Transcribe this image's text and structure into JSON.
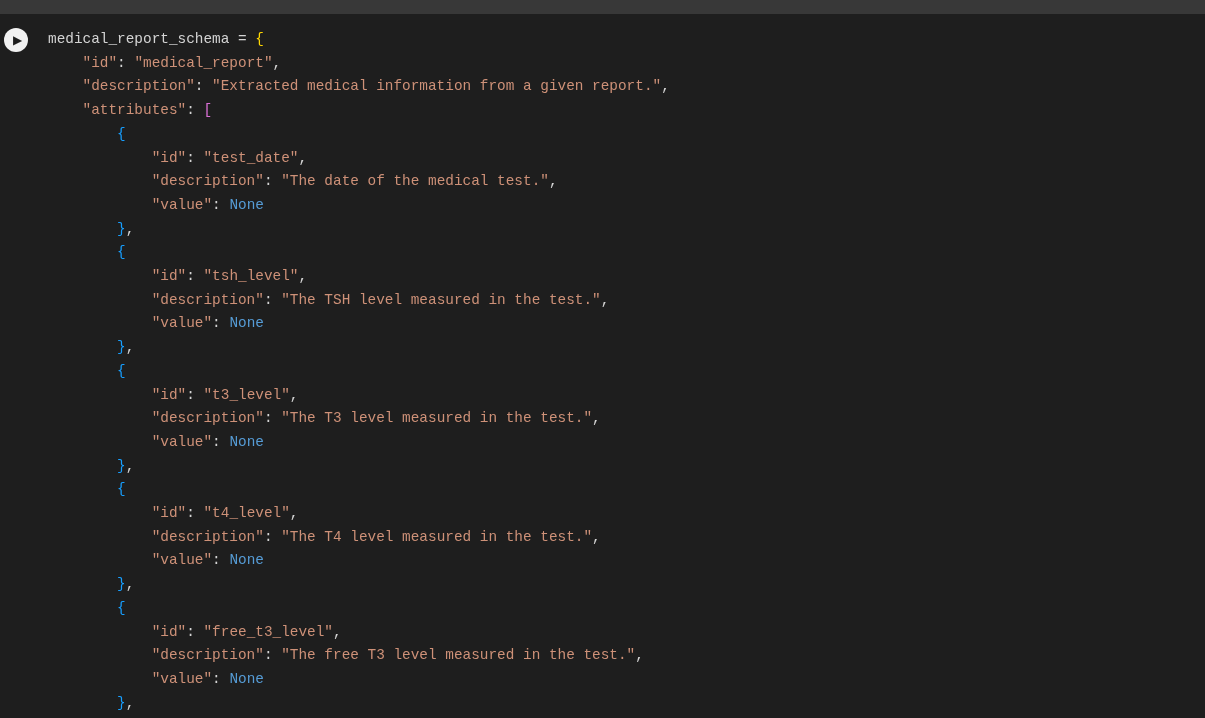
{
  "cell": {
    "run_button": {
      "label": "▶"
    },
    "lines": [
      [
        {
          "kind": "plain",
          "text": "medical_report_schema = "
        },
        {
          "kind": "bracket-1",
          "text": "{"
        }
      ],
      [
        {
          "kind": "string",
          "text": "    \"id\""
        },
        {
          "kind": "plain",
          "text": ": "
        },
        {
          "kind": "string",
          "text": "\"medical_report\""
        },
        {
          "kind": "plain",
          "text": ","
        }
      ],
      [
        {
          "kind": "string",
          "text": "    \"description\""
        },
        {
          "kind": "plain",
          "text": ": "
        },
        {
          "kind": "string",
          "text": "\"Extracted medical information from a given report.\""
        },
        {
          "kind": "plain",
          "text": ","
        }
      ],
      [
        {
          "kind": "string",
          "text": "    \"attributes\""
        },
        {
          "kind": "plain",
          "text": ": "
        },
        {
          "kind": "bracket-2",
          "text": "["
        }
      ],
      [
        {
          "kind": "bracket-3",
          "text": "        {"
        }
      ],
      [
        {
          "kind": "string",
          "text": "            \"id\""
        },
        {
          "kind": "plain",
          "text": ": "
        },
        {
          "kind": "string",
          "text": "\"test_date\""
        },
        {
          "kind": "plain",
          "text": ","
        }
      ],
      [
        {
          "kind": "string",
          "text": "            \"description\""
        },
        {
          "kind": "plain",
          "text": ": "
        },
        {
          "kind": "string",
          "text": "\"The date of the medical test.\""
        },
        {
          "kind": "plain",
          "text": ","
        }
      ],
      [
        {
          "kind": "string",
          "text": "            \"value\""
        },
        {
          "kind": "plain",
          "text": ": "
        },
        {
          "kind": "constant",
          "text": "None"
        }
      ],
      [
        {
          "kind": "bracket-3",
          "text": "        }"
        },
        {
          "kind": "plain",
          "text": ","
        }
      ],
      [
        {
          "kind": "bracket-3",
          "text": "        {"
        }
      ],
      [
        {
          "kind": "string",
          "text": "            \"id\""
        },
        {
          "kind": "plain",
          "text": ": "
        },
        {
          "kind": "string",
          "text": "\"tsh_level\""
        },
        {
          "kind": "plain",
          "text": ","
        }
      ],
      [
        {
          "kind": "string",
          "text": "            \"description\""
        },
        {
          "kind": "plain",
          "text": ": "
        },
        {
          "kind": "string",
          "text": "\"The TSH level measured in the test.\""
        },
        {
          "kind": "plain",
          "text": ","
        }
      ],
      [
        {
          "kind": "string",
          "text": "            \"value\""
        },
        {
          "kind": "plain",
          "text": ": "
        },
        {
          "kind": "constant",
          "text": "None"
        }
      ],
      [
        {
          "kind": "bracket-3",
          "text": "        }"
        },
        {
          "kind": "plain",
          "text": ","
        }
      ],
      [
        {
          "kind": "bracket-3",
          "text": "        {"
        }
      ],
      [
        {
          "kind": "string",
          "text": "            \"id\""
        },
        {
          "kind": "plain",
          "text": ": "
        },
        {
          "kind": "string",
          "text": "\"t3_level\""
        },
        {
          "kind": "plain",
          "text": ","
        }
      ],
      [
        {
          "kind": "string",
          "text": "            \"description\""
        },
        {
          "kind": "plain",
          "text": ": "
        },
        {
          "kind": "string",
          "text": "\"The T3 level measured in the test.\""
        },
        {
          "kind": "plain",
          "text": ","
        }
      ],
      [
        {
          "kind": "string",
          "text": "            \"value\""
        },
        {
          "kind": "plain",
          "text": ": "
        },
        {
          "kind": "constant",
          "text": "None"
        }
      ],
      [
        {
          "kind": "bracket-3",
          "text": "        }"
        },
        {
          "kind": "plain",
          "text": ","
        }
      ],
      [
        {
          "kind": "bracket-3",
          "text": "        {"
        }
      ],
      [
        {
          "kind": "string",
          "text": "            \"id\""
        },
        {
          "kind": "plain",
          "text": ": "
        },
        {
          "kind": "string",
          "text": "\"t4_level\""
        },
        {
          "kind": "plain",
          "text": ","
        }
      ],
      [
        {
          "kind": "string",
          "text": "            \"description\""
        },
        {
          "kind": "plain",
          "text": ": "
        },
        {
          "kind": "string",
          "text": "\"The T4 level measured in the test.\""
        },
        {
          "kind": "plain",
          "text": ","
        }
      ],
      [
        {
          "kind": "string",
          "text": "            \"value\""
        },
        {
          "kind": "plain",
          "text": ": "
        },
        {
          "kind": "constant",
          "text": "None"
        }
      ],
      [
        {
          "kind": "bracket-3",
          "text": "        }"
        },
        {
          "kind": "plain",
          "text": ","
        }
      ],
      [
        {
          "kind": "bracket-3",
          "text": "        {"
        }
      ],
      [
        {
          "kind": "string",
          "text": "            \"id\""
        },
        {
          "kind": "plain",
          "text": ": "
        },
        {
          "kind": "string",
          "text": "\"free_t3_level\""
        },
        {
          "kind": "plain",
          "text": ","
        }
      ],
      [
        {
          "kind": "string",
          "text": "            \"description\""
        },
        {
          "kind": "plain",
          "text": ": "
        },
        {
          "kind": "string",
          "text": "\"The free T3 level measured in the test.\""
        },
        {
          "kind": "plain",
          "text": ","
        }
      ],
      [
        {
          "kind": "string",
          "text": "            \"value\""
        },
        {
          "kind": "plain",
          "text": ": "
        },
        {
          "kind": "constant",
          "text": "None"
        }
      ],
      [
        {
          "kind": "bracket-3",
          "text": "        }"
        },
        {
          "kind": "plain",
          "text": ","
        }
      ]
    ]
  }
}
